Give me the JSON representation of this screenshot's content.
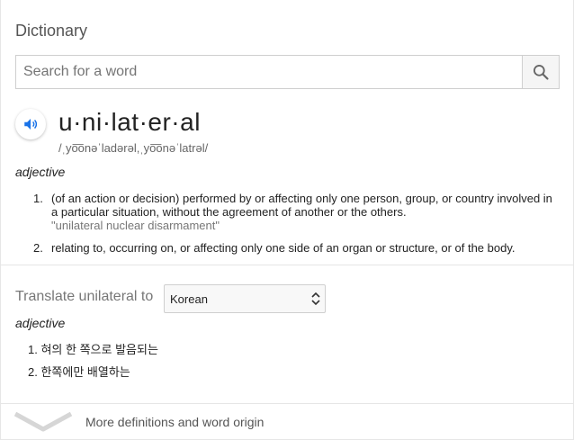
{
  "header": {
    "title": "Dictionary"
  },
  "search": {
    "placeholder": "Search for a word",
    "value": ""
  },
  "entry": {
    "word": "u·ni·lat·er·al",
    "phonetic": "/ˌyo͞onəˈladərəl,ˌyo͞onəˈlatrəl/",
    "part_of_speech": "adjective",
    "definitions": [
      {
        "number": "1.",
        "line1": "(of an action or decision) performed by or affecting only one person, group, or country involved in",
        "line2": "a particular situation, without the agreement of another or the others.",
        "example": "\"unilateral nuclear disarmament\""
      },
      {
        "number": "2.",
        "line1": "relating to, occurring on, or affecting only one side of an organ or structure, or of the body."
      }
    ]
  },
  "translate": {
    "label": "Translate unilateral to",
    "language": "Korean",
    "part_of_speech": "adjective",
    "items": [
      {
        "number": "1.",
        "text": "혀의 한 쪽으로 발음되는"
      },
      {
        "number": "2.",
        "text": "한쪽에만 배열하는"
      }
    ]
  },
  "footer": {
    "more_label": "More definitions and word origin"
  },
  "icons": {
    "search": "search-icon",
    "speaker": "speaker-icon",
    "select_arrows": "updown-arrows-icon",
    "expand": "chevron-down-icon"
  },
  "colors": {
    "speaker_blue": "#1a73e8",
    "muted_text": "#777777"
  }
}
